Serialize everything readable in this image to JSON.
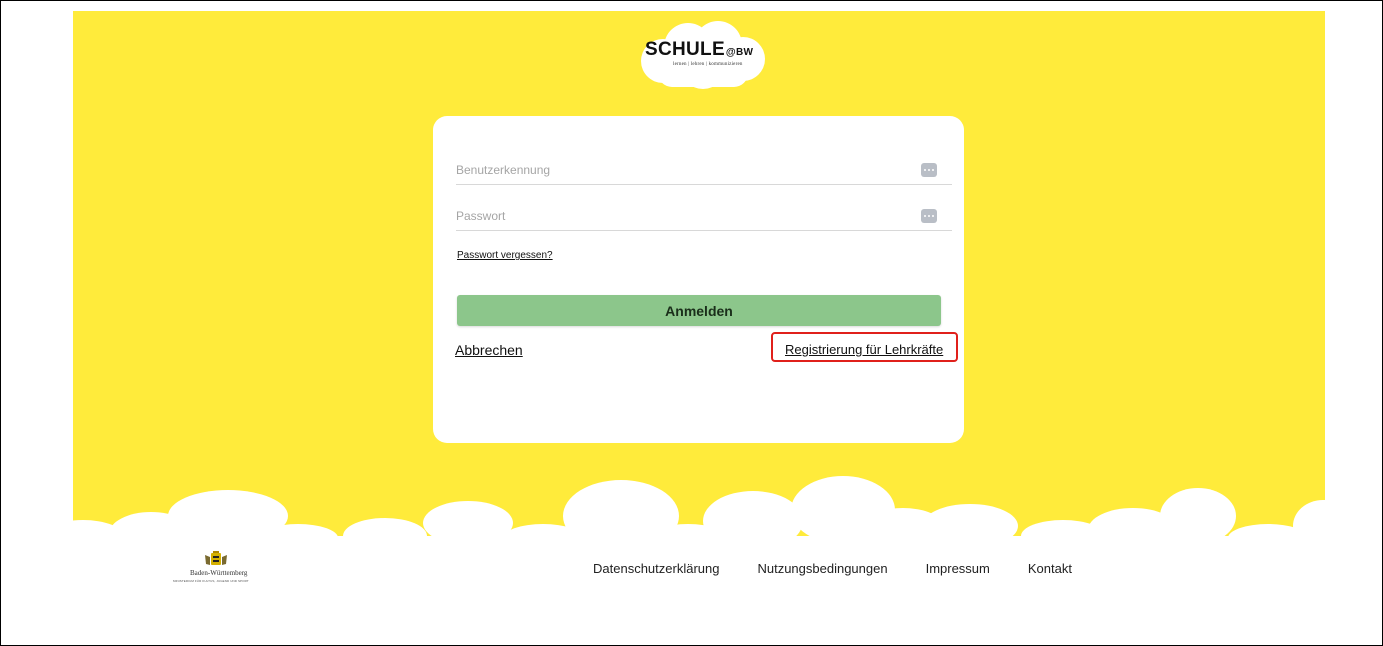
{
  "logo": {
    "main": "SCHULE",
    "suffix": "@BW",
    "tagline": "lernen | lehren | kommunizieren"
  },
  "login": {
    "username_placeholder": "Benutzerkennung",
    "password_placeholder": "Passwort",
    "forgot_password": "Passwort vergessen?",
    "submit_label": "Anmelden",
    "cancel_label": "Abbrechen",
    "register_label": "Registrierung für Lehrkräfte"
  },
  "footer": {
    "state_logo": {
      "name": "Baden-Württemberg",
      "ministry": "MINISTERIUM FÜR KULTUS, JUGEND UND SPORT"
    },
    "links": [
      "Datenschutzerklärung",
      "Nutzungsbedingungen",
      "Impressum",
      "Kontakt"
    ]
  },
  "colors": {
    "background": "#ffeb3b",
    "card": "#ffffff",
    "submit_button": "#8cc68b",
    "highlight_border": "#e0201b"
  },
  "icons": {
    "field_action": "keyboard-dots-icon"
  }
}
